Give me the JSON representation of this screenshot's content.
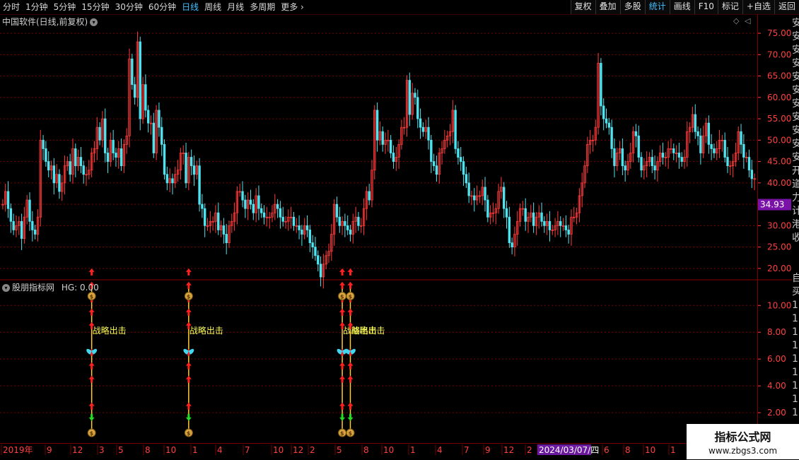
{
  "toolbar": {
    "left": [
      "分时",
      "1分钟",
      "5分钟",
      "15分钟",
      "30分钟",
      "60分钟",
      "日线",
      "周线",
      "月线",
      "多周期",
      "更多"
    ],
    "active_left": "日线",
    "right": [
      "复权",
      "叠加",
      "多股",
      "统计",
      "画线",
      "F10",
      "标记",
      "+自选",
      "返回"
    ],
    "active_right": "统计"
  },
  "main_title": "中国软件(日线,前复权)",
  "indicator_title": "股朋指标网",
  "indicator_value": "HG: 0.00",
  "price_label": "34.93",
  "signal_text": "战略出击",
  "x_labels": [
    "2019年",
    "9",
    "12",
    "3",
    "5",
    "8",
    "10",
    "1",
    "4",
    "7",
    "10",
    "12",
    "2",
    "5",
    "8",
    "10",
    "1",
    "4",
    "7",
    "9",
    "12",
    "2",
    "2024/03/07/四",
    "6",
    "8",
    "10",
    "1",
    "4",
    "7"
  ],
  "watermark": {
    "line1": "指标公式网",
    "line2": "www.zbgs3.com"
  },
  "right_chars": [
    "安",
    "安",
    "安",
    "安",
    "安",
    "安",
    "安",
    "安",
    "安",
    "安",
    "安",
    "开",
    "道",
    "力",
    "计",
    "港",
    "收",
    "",
    "",
    "自",
    "买",
    "1",
    "1",
    "1",
    "1",
    "1",
    "1",
    "1",
    "1",
    "1"
  ],
  "colors": {
    "up": "#ff3b3b",
    "down": "#4ee3ee",
    "grid": "#7a0000",
    "axis": "#ff4040",
    "signal": "#ffff55",
    "bg": "#000000"
  },
  "chart_data": {
    "type": "candlestick",
    "y_ticks": [
      20,
      25,
      30,
      35,
      40,
      45,
      50,
      55,
      60,
      65,
      70,
      75
    ],
    "ylim": [
      17.5,
      76.5
    ],
    "current_price": 34.93,
    "close": [
      35,
      38,
      34,
      31,
      29,
      30,
      31,
      27,
      32,
      36,
      31,
      29,
      28,
      32,
      50,
      48,
      45,
      43,
      44,
      40,
      42,
      38,
      40,
      44,
      45,
      42,
      48,
      44,
      46,
      44,
      42,
      42,
      43,
      47,
      48,
      53,
      50,
      55,
      47,
      45,
      50,
      47,
      46,
      48,
      44,
      49,
      51,
      69,
      63,
      60,
      73,
      55,
      63,
      57,
      54,
      54,
      47,
      57,
      53,
      49,
      42,
      40,
      41,
      40,
      42,
      43,
      47,
      47,
      40,
      46,
      44,
      42,
      44,
      35,
      34,
      30,
      30,
      31,
      31,
      33,
      29,
      30,
      28,
      26,
      30,
      31,
      33,
      38,
      38,
      36,
      34,
      36,
      35,
      33,
      37,
      34,
      33,
      32,
      32,
      32,
      33,
      35,
      34,
      32,
      31,
      31,
      32,
      32,
      30,
      30,
      29,
      28,
      30,
      29,
      26,
      25,
      23,
      21,
      18,
      21,
      23,
      24,
      28,
      35,
      32,
      30,
      31,
      30,
      29,
      28,
      31,
      32,
      30,
      30,
      34,
      38,
      36,
      43,
      57,
      50,
      52,
      49,
      50,
      50,
      47,
      45,
      46,
      49,
      53,
      53,
      64,
      56,
      61,
      60,
      55,
      53,
      52,
      53,
      50,
      45,
      44,
      42,
      47,
      48,
      50,
      51,
      52,
      57,
      48,
      46,
      45,
      42,
      40,
      37,
      37,
      36,
      37,
      37,
      39,
      36,
      32,
      33,
      33,
      34,
      38,
      39,
      34,
      32,
      26,
      25,
      28,
      31,
      34,
      34,
      31,
      32,
      33,
      30,
      32,
      33,
      31,
      30,
      31,
      29,
      29,
      30,
      31,
      30,
      30,
      29,
      28,
      32,
      32,
      33,
      37,
      40,
      44,
      49,
      50,
      50,
      53,
      68,
      58,
      55,
      54,
      53,
      48,
      44,
      47,
      48,
      44,
      43,
      45,
      47,
      52,
      51,
      46,
      43,
      44,
      45,
      46,
      44,
      43,
      45,
      47,
      46,
      46,
      48,
      48,
      47,
      47,
      46,
      45,
      46,
      52,
      53,
      56,
      52,
      51,
      47,
      51,
      54,
      49,
      48,
      47,
      48,
      50,
      50,
      46,
      44,
      44,
      45,
      47,
      52,
      49,
      46,
      46,
      43,
      41,
      41
    ]
  },
  "signals": {
    "clusters": [
      {
        "bar": 33,
        "label": "战略出击"
      },
      {
        "bar": 69,
        "label": "战略出击"
      },
      {
        "bar": 126,
        "label": "战略出击"
      },
      {
        "bar": 129,
        "label": "战略出击"
      }
    ],
    "y_ticks": [
      "2.00",
      "4.00",
      "6.00",
      "8.00",
      "10.00"
    ],
    "arrow_levels": [
      2.5,
      4.5,
      5.5,
      6.5,
      8.5,
      9.5,
      10.5,
      11.5,
      12.5
    ]
  }
}
